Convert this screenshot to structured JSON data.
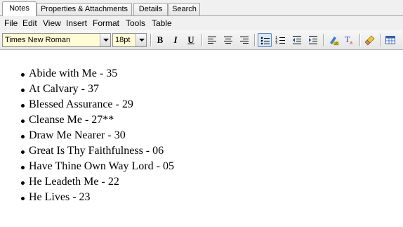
{
  "tabs": [
    {
      "label": "Notes",
      "active": true
    },
    {
      "label": "Properties & Attachments",
      "active": false
    },
    {
      "label": "Details",
      "active": false
    },
    {
      "label": "Search",
      "active": false
    }
  ],
  "menu": [
    "File",
    "Edit",
    "View",
    "Insert",
    "Format",
    "Tools",
    "Table"
  ],
  "toolbar": {
    "font_family": "Times New Roman",
    "font_size": "18pt",
    "bold_label": "B",
    "italic_label": "I",
    "underline_label": "U",
    "combo_bg": "#fffbd6",
    "active_button": "bullet-list"
  },
  "notes": [
    "Abide with Me - 35",
    "At Calvary - 37",
    "Blessed Assurance - 29",
    "Cleanse Me - 27**",
    "Draw Me Nearer - 30",
    "Great Is Thy Faithfulness - 06",
    "Have Thine Own Way Lord - 05",
    "He Leadeth Me - 22",
    "He Lives - 23"
  ]
}
